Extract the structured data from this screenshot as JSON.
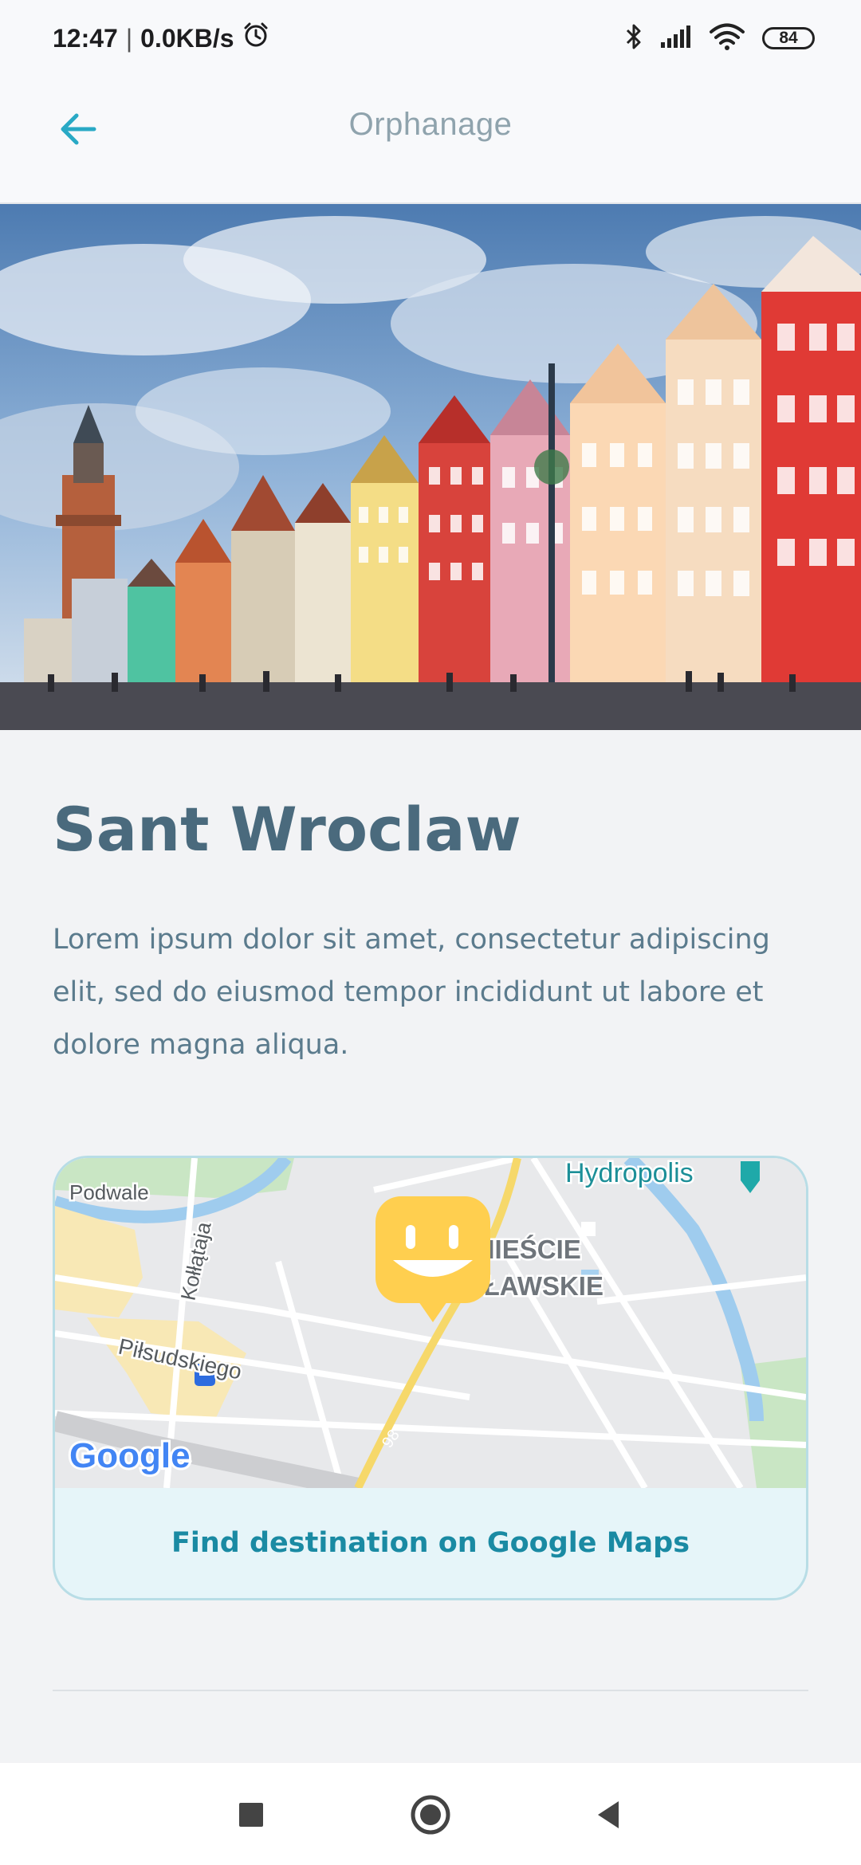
{
  "status_bar": {
    "time": "12:47",
    "network_speed": "0.0KB/s",
    "battery_level": "84",
    "icons": [
      "alarm-icon",
      "bluetooth-icon",
      "signal-icon",
      "wifi-icon",
      "battery-icon"
    ]
  },
  "app_bar": {
    "title": "Orphanage",
    "back_icon": "arrow-left-icon"
  },
  "place": {
    "name": "Sant Wroclaw",
    "description": "Lorem ipsum dolor sit amet, consectetur adipiscing elit, sed do eiusmod tempor incididunt ut labore et dolore magna aliqua."
  },
  "map": {
    "labels": {
      "podwale": "Podwale",
      "hydropolis": "Hydropolis",
      "kollataja": "Kołłątaja",
      "pilsudskiego": "Piłsudskiego",
      "district_line1": "PRZEDMIEŚCIE",
      "district_line2": "OŁAWSKIE",
      "road_98": "98"
    },
    "logo_text": "Google",
    "button_label": "Find destination on Google Maps",
    "marker_icon": "smiley-marker-icon"
  },
  "nav_bar": {
    "icons": [
      "recents-square-icon",
      "home-circle-icon",
      "back-triangle-icon"
    ]
  },
  "colors": {
    "accent": "#29a9c5",
    "title": "#4a6a7d",
    "body_text": "#5b7b8d",
    "button_text": "#1a8aa3",
    "marker": "#ffcf4f"
  }
}
